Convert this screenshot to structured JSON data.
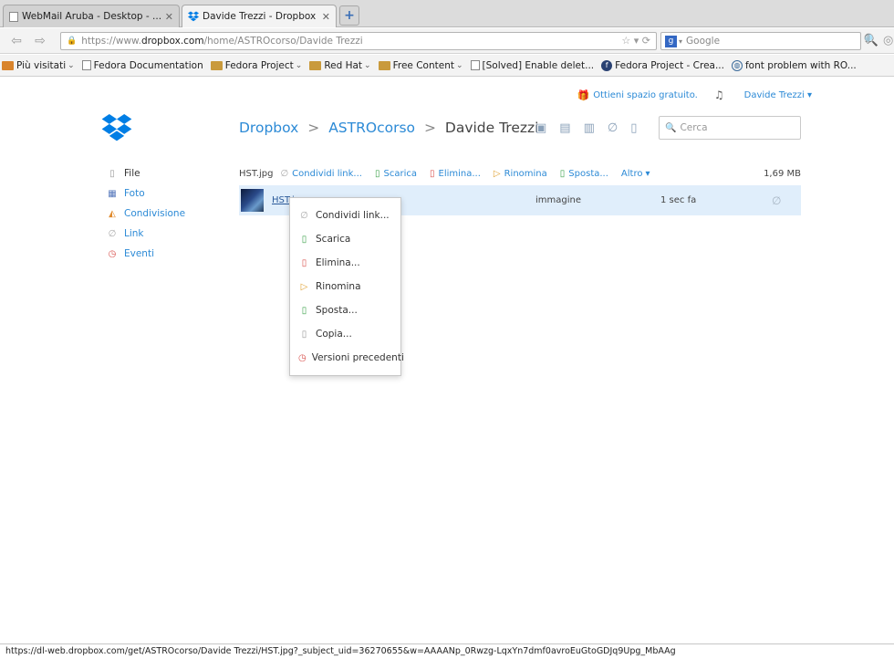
{
  "browser": {
    "tabs": [
      {
        "title": "WebMail Aruba - Desktop - ...",
        "active": false
      },
      {
        "title": "Davide Trezzi - Dropbox",
        "active": true
      }
    ],
    "url": {
      "protocol": "https://www.",
      "host": "dropbox.com",
      "path": "/home/ASTROcorso/Davide Trezzi"
    },
    "search_placeholder": "Google",
    "bookmarks": [
      {
        "label": "Più visitati",
        "icon": "folder-icon",
        "dropdown": true
      },
      {
        "label": "Fedora Documentation",
        "icon": "page-icon",
        "dropdown": false
      },
      {
        "label": "Fedora Project",
        "icon": "folder-icon",
        "dropdown": true
      },
      {
        "label": "Red Hat",
        "icon": "folder-icon",
        "dropdown": true
      },
      {
        "label": "Free Content",
        "icon": "folder-icon",
        "dropdown": true
      },
      {
        "label": "[Solved] Enable delet...",
        "icon": "page-icon",
        "dropdown": false
      },
      {
        "label": "Fedora Project - Crea...",
        "icon": "fedora-icon",
        "dropdown": false
      },
      {
        "label": "font problem with RO...",
        "icon": "globe-icon",
        "dropdown": false
      }
    ],
    "status_url": "https://dl-web.dropbox.com/get/ASTROcorso/Davide Trezzi/HST.jpg?_subject_uid=36270655&w=AAAANp_0Rwzg-LqxYn7dmf0avroEuGtoGDJq9Upg_MbAAg"
  },
  "header": {
    "free_space_link": "Ottieni spazio gratuito.",
    "user_name": "Davide Trezzi"
  },
  "breadcrumb": {
    "root": "Dropbox",
    "parent": "ASTROcorso",
    "current": "Davide Trezzi",
    "separator": ">"
  },
  "search": {
    "placeholder": "Cerca"
  },
  "sidebar": {
    "items": [
      {
        "label": "File",
        "icon": "file-icon",
        "selected": true
      },
      {
        "label": "Foto",
        "icon": "photo-icon",
        "selected": false
      },
      {
        "label": "Condivisione",
        "icon": "share-icon",
        "selected": false
      },
      {
        "label": "Link",
        "icon": "link-icon",
        "selected": false
      },
      {
        "label": "Eventi",
        "icon": "events-icon",
        "selected": false
      }
    ]
  },
  "actionbar": {
    "selected_file": "HST.jpg",
    "actions": [
      {
        "label": "Condividi link...",
        "icon": "link-icon"
      },
      {
        "label": "Scarica",
        "icon": "download-icon"
      },
      {
        "label": "Elimina...",
        "icon": "delete-icon"
      },
      {
        "label": "Rinomina",
        "icon": "rename-icon"
      },
      {
        "label": "Sposta...",
        "icon": "move-icon"
      }
    ],
    "more_label": "Altro",
    "size": "1,69 MB"
  },
  "file_row": {
    "name": "HST.j",
    "kind": "immagine",
    "modified": "1 sec fa"
  },
  "context_menu": {
    "items": [
      {
        "label": "Condividi link...",
        "icon": "link-icon"
      },
      {
        "label": "Scarica",
        "icon": "download-icon"
      },
      {
        "label": "Elimina...",
        "icon": "delete-icon"
      },
      {
        "label": "Rinomina",
        "icon": "rename-icon"
      },
      {
        "label": "Sposta...",
        "icon": "move-icon"
      },
      {
        "label": "Copia...",
        "icon": "copy-icon"
      },
      {
        "label": "Versioni precedenti",
        "icon": "history-icon"
      }
    ]
  },
  "colors": {
    "link": "#2c8ad6",
    "selected_row": "#e0eefb",
    "brand": "#007ee5"
  }
}
